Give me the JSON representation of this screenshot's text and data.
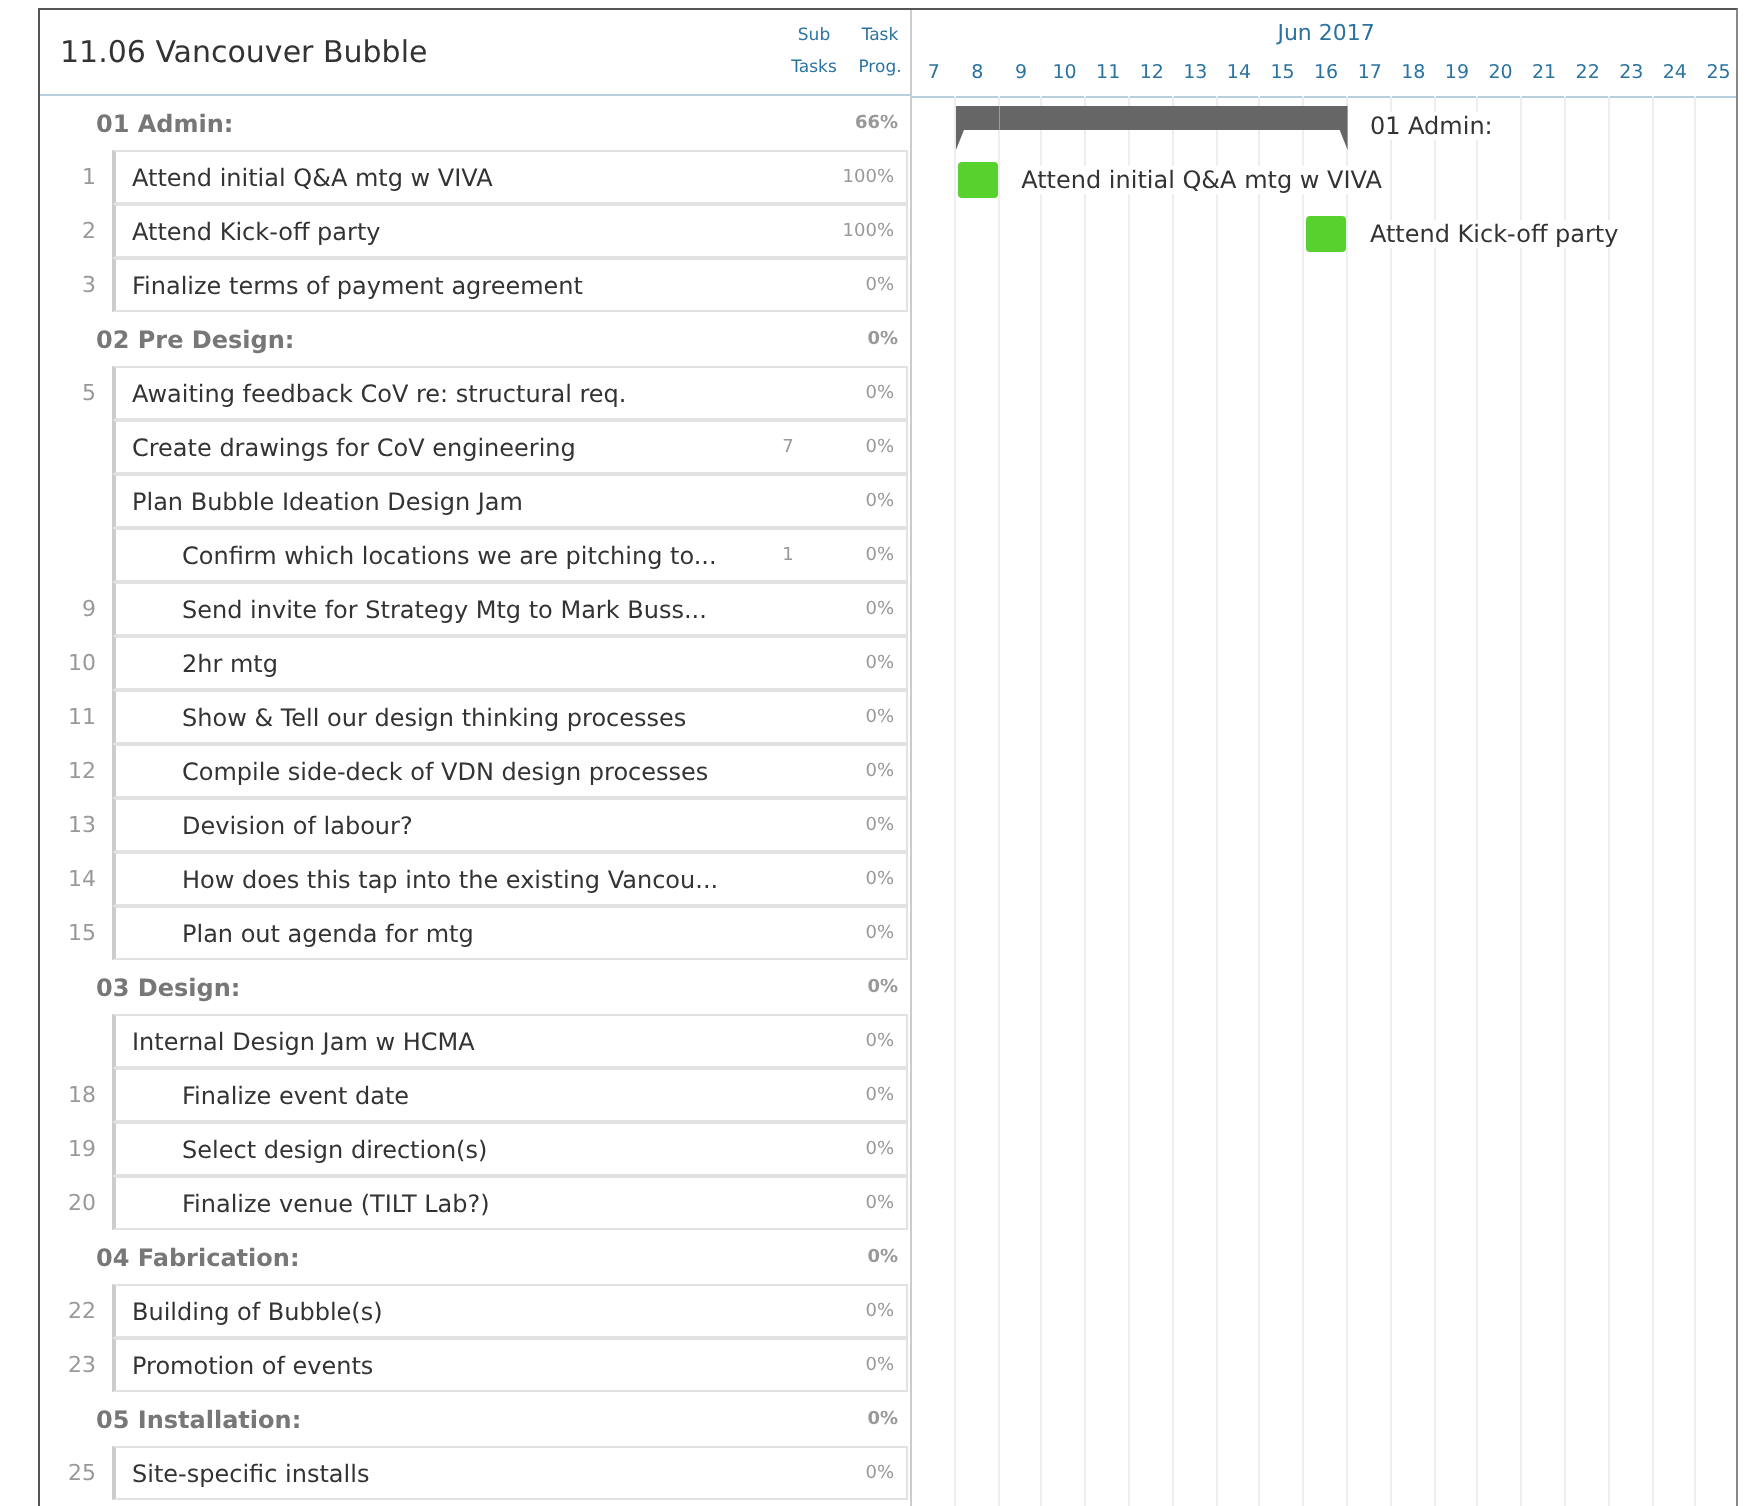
{
  "project": {
    "title": "11.06 Vancouver Bubble",
    "subtasks_heading": "Sub Tasks",
    "progress_heading": "Task Prog."
  },
  "timeline": {
    "month": "Jun 2017",
    "days": [
      "7",
      "8",
      "9",
      "10",
      "11",
      "12",
      "13",
      "14",
      "15",
      "16",
      "17",
      "18",
      "19",
      "20",
      "21",
      "22",
      "23",
      "24",
      "25"
    ]
  },
  "groups": [
    {
      "name": "01 Admin:",
      "progress": "66%",
      "bar": {
        "cells": [
          false,
          true,
          true,
          true,
          true,
          true,
          true,
          true,
          true,
          true,
          false,
          false,
          false,
          false,
          false,
          false,
          false,
          false,
          false
        ],
        "label": "01 Admin:"
      },
      "tasks": [
        {
          "number": "1",
          "name": "Attend initial Q&A mtg w VIVA",
          "progress": "100%",
          "bar": {
            "cells": [
              false,
              true,
              false,
              false,
              false,
              false,
              false,
              false,
              false,
              false,
              false,
              false,
              false,
              false,
              false,
              false,
              false,
              false,
              false
            ],
            "label": "Attend initial Q&A mtg w VIVA"
          }
        },
        {
          "number": "2",
          "name": "Attend Kick-off party",
          "progress": "100%",
          "bar": {
            "cells": [
              false,
              false,
              false,
              false,
              false,
              false,
              false,
              false,
              false,
              true,
              false,
              false,
              false,
              false,
              false,
              false,
              false,
              false,
              false
            ],
            "label": "Attend Kick-off party"
          }
        },
        {
          "number": "3",
          "name": "Finalize terms of payment agreement",
          "progress": "0%"
        }
      ]
    },
    {
      "name": "02 Pre Design:",
      "progress": "0%",
      "tasks": [
        {
          "number": "5",
          "name": "Awaiting feedback CoV re: structural req.",
          "progress": "0%"
        },
        {
          "name": "Create drawings for CoV engineering",
          "subtasks": "7",
          "progress": "0%"
        },
        {
          "name": "Plan Bubble Ideation Design Jam",
          "progress": "0%",
          "children": [
            {
              "name": "Confirm which locations we are pitching to...",
              "subtasks": "1",
              "progress": "0%"
            },
            {
              "number": "9",
              "name": "Send invite for Strategy Mtg to Mark Buss...",
              "progress": "0%"
            },
            {
              "number": "10",
              "name": "2hr mtg",
              "progress": "0%"
            },
            {
              "number": "11",
              "name": "Show & Tell our design thinking processes",
              "progress": "0%"
            },
            {
              "number": "12",
              "name": "Compile side-deck of VDN design processes",
              "progress": "0%"
            },
            {
              "number": "13",
              "name": "Devision of labour?",
              "progress": "0%"
            },
            {
              "number": "14",
              "name": "How does this tap into the existing Vancou...",
              "progress": "0%"
            },
            {
              "number": "15",
              "name": "Plan out agenda for mtg",
              "progress": "0%"
            }
          ]
        }
      ]
    },
    {
      "name": "03 Design:",
      "progress": "0%",
      "tasks": [
        {
          "name": "Internal Design Jam w HCMA",
          "progress": "0%",
          "children": [
            {
              "number": "18",
              "name": "Finalize event date",
              "progress": "0%"
            },
            {
              "number": "19",
              "name": "Select design direction(s)",
              "progress": "0%"
            },
            {
              "number": "20",
              "name": "Finalize venue (TILT Lab?)",
              "progress": "0%"
            }
          ]
        }
      ]
    },
    {
      "name": "04 Fabrication:",
      "progress": "0%",
      "tasks": [
        {
          "number": "22",
          "name": "Building of Bubble(s)",
          "progress": "0%"
        },
        {
          "number": "23",
          "name": "Promotion of events",
          "progress": "0%"
        }
      ]
    },
    {
      "name": "05 Installation:",
      "progress": "0%",
      "tasks": [
        {
          "number": "25",
          "name": "Site-specific installs",
          "progress": "0%"
        }
      ]
    }
  ]
}
